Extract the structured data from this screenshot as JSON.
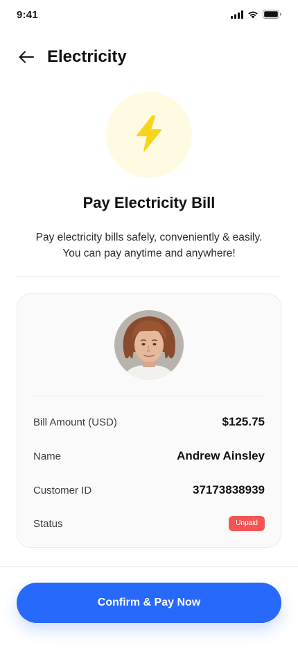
{
  "status_bar": {
    "time": "9:41"
  },
  "header": {
    "title": "Electricity"
  },
  "hero": {
    "title": "Pay Electricity Bill",
    "subtitle_line1": "Pay electricity bills safely, conveniently & easily.",
    "subtitle_line2": "You can pay anytime and anywhere!"
  },
  "bill": {
    "rows": [
      {
        "label": "Bill Amount (USD)",
        "value": "$125.75"
      },
      {
        "label": "Name",
        "value": "Andrew Ainsley"
      },
      {
        "label": "Customer ID",
        "value": "37173838939"
      },
      {
        "label": "Status",
        "value": "Unpaid"
      }
    ]
  },
  "cta": {
    "label": "Confirm & Pay Now"
  },
  "colors": {
    "primary": "#2769fb",
    "bolt": "#f8d51a",
    "bolt_bg": "#fffbe3",
    "unpaid": "#f35555"
  },
  "icons": [
    "signal-icon",
    "wifi-icon",
    "battery-icon",
    "back-arrow-icon",
    "lightning-bolt-icon"
  ]
}
